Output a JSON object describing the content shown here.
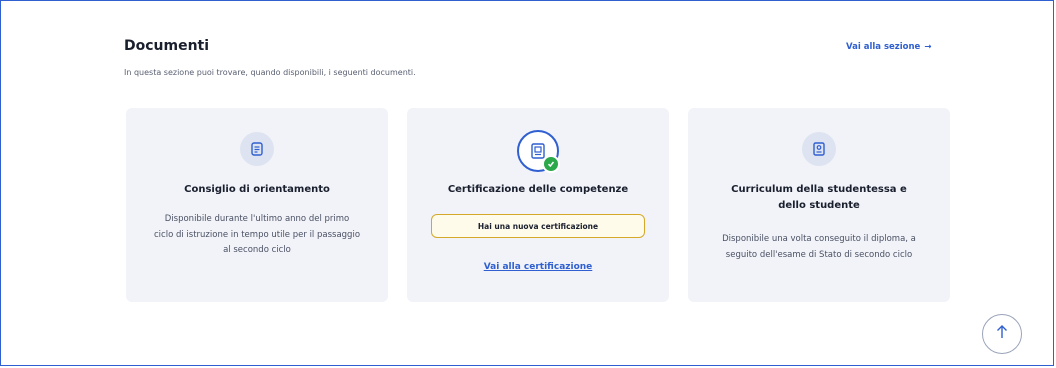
{
  "section": {
    "title": "Documenti",
    "subtitle": "In questa sezione puoi trovare, quando disponibili, i seguenti documenti.",
    "link_label": "Vai alla sezione",
    "link_arrow": "→"
  },
  "cards": [
    {
      "icon": "document-icon",
      "title": "Consiglio di orientamento",
      "description": "Disponibile durante l'ultimo anno del primo ciclo di istruzione in tempo utile per il passaggio al secondo ciclo"
    },
    {
      "icon": "certificate-icon",
      "title": "Certificazione delle competenze",
      "badge": "Hai una nuova certificazione",
      "link_label": "Vai alla certificazione"
    },
    {
      "icon": "curriculum-icon",
      "title": "Curriculum della studentessa e dello studente",
      "description": "Disponibile una volta conseguito il diploma, a seguito dell'esame di Stato di secondo ciclo"
    }
  ],
  "colors": {
    "accent": "#2f5fd0",
    "card_bg": "#f1f3f8",
    "success": "#2aa84a",
    "badge_border": "#d4a92a"
  }
}
